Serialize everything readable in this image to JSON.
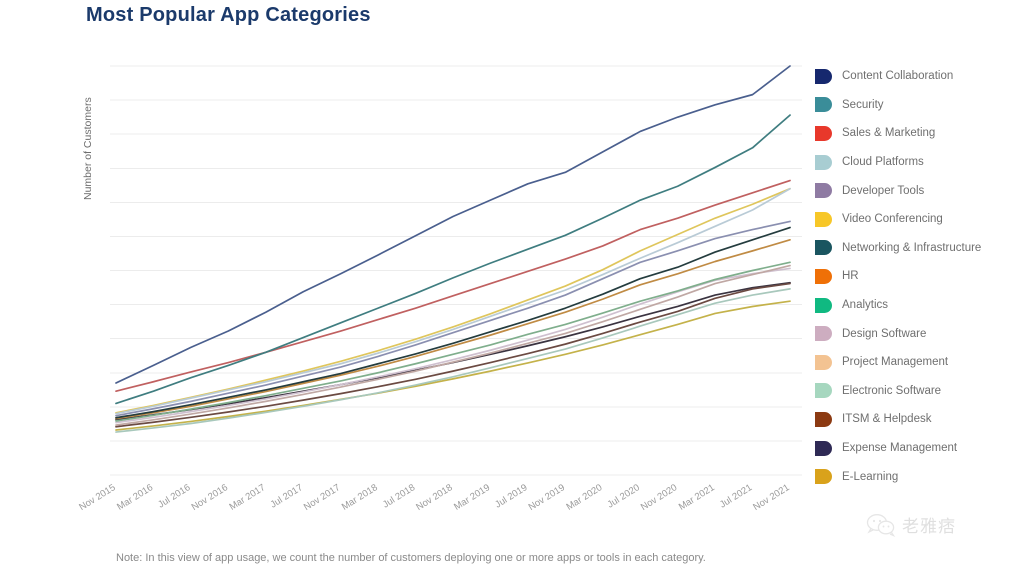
{
  "title": "Most Popular App Categories",
  "note": "Note: In this view of app usage, we count the number of customers deploying one or more apps or tools in each category.",
  "y_axis_title": "Number of Customers",
  "watermark": {
    "text": "老雅痞",
    "icon": "wechat-icon"
  },
  "chart_data": {
    "type": "line",
    "title": "Most Popular App Categories",
    "xlabel": "",
    "ylabel": "Number of Customers",
    "grid": true,
    "legend_position": "right",
    "y_tick_labels_shown": false,
    "ylim": [
      0,
      1000
    ],
    "gridline_count": 13,
    "x": [
      "Nov 2015",
      "Mar 2016",
      "Jul 2016",
      "Nov 2016",
      "Mar 2017",
      "Jul 2017",
      "Nov 2017",
      "Mar 2018",
      "Jul 2018",
      "Nov 2018",
      "Mar 2019",
      "Jul 2019",
      "Nov 2019",
      "Mar 2020",
      "Jul 2020",
      "Nov 2020",
      "Mar 2021",
      "Jul 2021",
      "Nov 2021"
    ],
    "categories": [
      "Nov 2015",
      "Mar 2016",
      "Jul 2016",
      "Nov 2016",
      "Mar 2017",
      "Jul 2017",
      "Nov 2017",
      "Mar 2018",
      "Jul 2018",
      "Nov 2018",
      "Mar 2019",
      "Jul 2019",
      "Nov 2019",
      "Mar 2020",
      "Jul 2020",
      "Nov 2020",
      "Mar 2021",
      "Jul 2021",
      "Nov 2021"
    ],
    "series": [
      {
        "name": "Content Collaboration",
        "color": "#16286e",
        "line_color": "#4a5f8e",
        "values": [
          225,
          268,
          312,
          352,
          398,
          448,
          492,
          538,
          585,
          632,
          672,
          712,
          740,
          790,
          840,
          875,
          905,
          930,
          1000
        ]
      },
      {
        "name": "Security",
        "color": "#3a8d99",
        "line_color": "#3f7d80",
        "values": [
          175,
          205,
          238,
          268,
          300,
          336,
          372,
          408,
          444,
          482,
          518,
          552,
          586,
          628,
          672,
          706,
          752,
          800,
          880
        ]
      },
      {
        "name": "Sales & Marketing",
        "color": "#e8382b",
        "line_color": "#c06060",
        "values": [
          205,
          228,
          252,
          275,
          300,
          326,
          352,
          380,
          408,
          438,
          468,
          498,
          528,
          560,
          600,
          628,
          660,
          690,
          720
        ]
      },
      {
        "name": "Cloud Platforms",
        "color": "#a8cdd2",
        "line_color": "#b9cbd6",
        "values": [
          150,
          168,
          188,
          208,
          228,
          250,
          272,
          298,
          326,
          356,
          388,
          420,
          452,
          490,
          530,
          568,
          608,
          648,
          700
        ]
      },
      {
        "name": "Developer Tools",
        "color": "#8f7ba3",
        "line_color": "#8a8fb0",
        "values": [
          145,
          162,
          180,
          200,
          220,
          242,
          264,
          290,
          318,
          348,
          378,
          408,
          440,
          480,
          520,
          548,
          578,
          600,
          620
        ]
      },
      {
        "name": "Video Conferencing",
        "color": "#f7c728",
        "line_color": "#dfc65c",
        "values": [
          152,
          170,
          190,
          210,
          232,
          254,
          278,
          304,
          332,
          362,
          394,
          428,
          462,
          502,
          548,
          588,
          628,
          662,
          700
        ]
      },
      {
        "name": "Networking & Infrastructure",
        "color": "#1a5560",
        "line_color": "#243c3e",
        "values": [
          140,
          155,
          172,
          190,
          208,
          228,
          248,
          272,
          296,
          322,
          350,
          378,
          408,
          442,
          480,
          508,
          545,
          575,
          605
        ]
      },
      {
        "name": "HR",
        "color": "#ef7007",
        "line_color": "#c08b44",
        "values": [
          138,
          152,
          168,
          186,
          204,
          224,
          244,
          266,
          290,
          316,
          342,
          370,
          398,
          430,
          465,
          492,
          522,
          548,
          575
        ]
      },
      {
        "name": "Analytics",
        "color": "#10b981",
        "line_color": "#7fae8c",
        "values": [
          132,
          146,
          161,
          177,
          194,
          212,
          230,
          250,
          272,
          295,
          318,
          344,
          368,
          396,
          425,
          450,
          478,
          500,
          520
        ]
      },
      {
        "name": "Design Software",
        "color": "#cdadc0",
        "line_color": "#c0a8a4",
        "values": [
          122,
          135,
          149,
          164,
          180,
          197,
          215,
          234,
          254,
          276,
          298,
          322,
          346,
          375,
          405,
          435,
          468,
          490,
          512
        ]
      },
      {
        "name": "Project Management",
        "color": "#f3c392",
        "line_color": "#cfc0cf",
        "values": [
          128,
          141,
          155,
          170,
          186,
          203,
          221,
          240,
          260,
          282,
          305,
          330,
          356,
          386,
          418,
          448,
          476,
          492,
          505
        ]
      },
      {
        "name": "Electronic Software",
        "color": "#a6d7bf",
        "line_color": "#a8c8bc",
        "values": [
          105,
          115,
          126,
          139,
          153,
          168,
          184,
          201,
          220,
          240,
          262,
          285,
          308,
          335,
          364,
          392,
          420,
          440,
          455
        ]
      },
      {
        "name": "ITSM & Helpdesk",
        "color": "#8c3a12",
        "line_color": "#6b4a42",
        "values": [
          118,
          129,
          141,
          154,
          168,
          183,
          199,
          216,
          234,
          254,
          275,
          297,
          320,
          346,
          374,
          400,
          432,
          455,
          468
        ]
      },
      {
        "name": "Expense Management",
        "color": "#2f2a55",
        "line_color": "#3a3340",
        "values": [
          135,
          147,
          160,
          174,
          189,
          205,
          221,
          238,
          256,
          275,
          295,
          316,
          338,
          362,
          388,
          412,
          440,
          458,
          470
        ]
      },
      {
        "name": "E-Learning",
        "color": "#d9a21b",
        "line_color": "#c4b24a",
        "values": [
          110,
          120,
          131,
          143,
          156,
          170,
          185,
          200,
          217,
          235,
          254,
          274,
          295,
          318,
          343,
          368,
          395,
          412,
          425
        ]
      }
    ]
  },
  "legend": {
    "items": [
      {
        "label": "Content Collaboration",
        "color": "#16286e"
      },
      {
        "label": "Security",
        "color": "#3a8d99"
      },
      {
        "label": "Sales & Marketing",
        "color": "#e8382b"
      },
      {
        "label": "Cloud Platforms",
        "color": "#a8cdd2"
      },
      {
        "label": "Developer Tools",
        "color": "#8f7ba3"
      },
      {
        "label": "Video Conferencing",
        "color": "#f7c728"
      },
      {
        "label": "Networking & Infrastructure",
        "color": "#1a5560"
      },
      {
        "label": "HR",
        "color": "#ef7007"
      },
      {
        "label": "Analytics",
        "color": "#10b981"
      },
      {
        "label": "Design Software",
        "color": "#cdadc0"
      },
      {
        "label": "Project Management",
        "color": "#f3c392"
      },
      {
        "label": "Electronic Software",
        "color": "#a6d7bf"
      },
      {
        "label": "ITSM & Helpdesk",
        "color": "#8c3a12"
      },
      {
        "label": "Expense Management",
        "color": "#2f2a55"
      },
      {
        "label": "E-Learning",
        "color": "#d9a21b"
      }
    ]
  }
}
